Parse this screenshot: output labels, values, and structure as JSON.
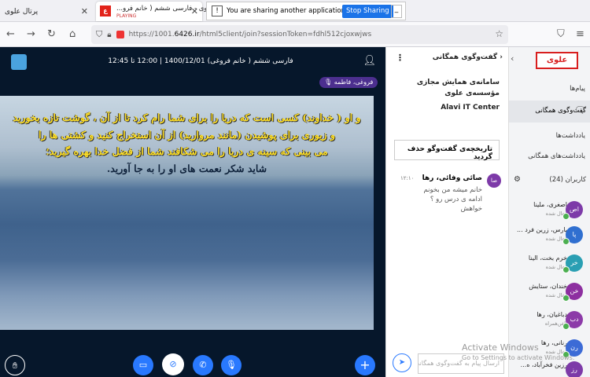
{
  "browser": {
    "tabs": [
      {
        "label": "پرتال علوی"
      },
      {
        "label": "علوی - فارسی ششم ( خانم فرو...",
        "sublabel": "PLAYING"
      }
    ],
    "share_message": "You are sharing another application window.",
    "stop_sharing_label": "Stop Sharing",
    "url_prefix": "https://1001.",
    "url_domain": "6426.ir",
    "url_suffix": "/html5client/join?sessionToken=fdhl512cjoxwjws"
  },
  "meeting": {
    "title": "فارسی ششم ( خانم فروغی) 1400/12/01 | 12:00 تا 12:45",
    "speaker": "فروغی، فاطمه",
    "slide": {
      "line1": "و او ( خداوند) کسی است که دریا را برای شما رام کرد تا از آن ، گوشت تازه بخورید",
      "line2": "و زیوری برای پوشیدن (مانند مروارید) از آن استخراج کنید و کشتی ها را",
      "line3": "می بینی که سینه ی دریا را می شکافند شما از فضل خدا بهره گیرید؛",
      "line4": "شاید شکر نعمت های او را به جا آورید."
    }
  },
  "chat": {
    "header": "گفت‌وگوی همگانی",
    "welcome_line1": "سامانه‌ی همایش مجازی",
    "welcome_line2": "مؤسسه‌ی علوی",
    "welcome_en": "Alavi IT Center",
    "clear_history": "تاریخچه‌ی گفت‌وگو حذف گردید",
    "message": {
      "avatar": "صا",
      "name": "صائی وفائی، رها",
      "time": "۱۲:۱۰",
      "text": "خانم میشه من بخونم ادامه ی درس رو ؟ خواهش"
    },
    "input_placeholder": "ارسال پیام به گفت‌وگوی همگانی"
  },
  "sidebar": {
    "logo": "علوی",
    "messages_label": "پیام‌ها",
    "public_chat_label": "گفت‌وگوی همگانی",
    "notes_label": "یادداشت‌ها",
    "shared_notes_label": "یادداشت‌های همگانی",
    "users_label": "کاربران (24)",
    "users": [
      {
        "name": "اصغری، ملینا",
        "status": "فعال شده",
        "avatar": "اص",
        "color": "#7d3aa8"
      },
      {
        "name": "پارس، زرین فرد ...",
        "status": "فعال شده",
        "avatar": "پا",
        "color": "#2f6fd0"
      },
      {
        "name": "خرم بخت، الینا",
        "status": "فعال شده",
        "avatar": "خر",
        "color": "#2a9fb3"
      },
      {
        "name": "خندان، ستایش",
        "status": "فعال شده",
        "avatar": "خن",
        "color": "#8d2fa0"
      },
      {
        "name": "دباغیان، رها",
        "status": "تلفن‌همراه",
        "avatar": "دب",
        "color": "#8c3aa8"
      },
      {
        "name": "رنانی، رها",
        "status": "فعال شده",
        "avatar": "رن",
        "color": "#3c6bd6"
      },
      {
        "name": "رزین فخرآباد، ه...",
        "status": "",
        "avatar": "رز",
        "color": "#7d3aa8"
      }
    ]
  },
  "watermark": {
    "line1": "Activate Windows",
    "line2": "Go to Settings to activate Windows."
  },
  "colors": {
    "accent": "#2979ff",
    "meeting_bg": "#06172b",
    "slide_text": "#ffe028",
    "speaker_badge": "#4c2f8f"
  },
  "icons": [
    "back-arrow-icon",
    "forward-arrow-icon",
    "reload-icon",
    "home-icon",
    "shield-icon",
    "lock-icon",
    "star-icon",
    "user-icon",
    "hand-raise-icon",
    "screen-share-icon",
    "camera-off-icon",
    "phone-icon",
    "microphone-icon",
    "plus-icon",
    "send-icon",
    "gear-icon",
    "chat-icon"
  ]
}
